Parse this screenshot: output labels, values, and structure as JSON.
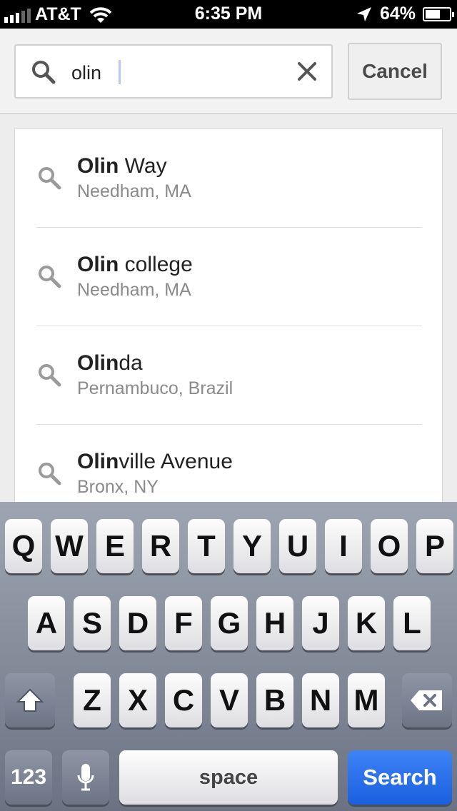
{
  "status_bar": {
    "carrier": "AT&T",
    "time": "6:35 PM",
    "battery": "64%",
    "battery_level": 0.64,
    "icons": [
      "signal-icon",
      "wifi-icon",
      "location-arrow-icon",
      "battery-icon"
    ]
  },
  "search": {
    "value": "olin",
    "cancel_label": "Cancel",
    "icons": [
      "search-icon",
      "clear-icon"
    ]
  },
  "results": [
    {
      "match": "Olin",
      "rest": " Way",
      "subtitle": "Needham, MA"
    },
    {
      "match": "Olin",
      "rest": " college",
      "subtitle": "Needham, MA"
    },
    {
      "match": "Olin",
      "rest": "da",
      "subtitle": "Pernambuco, Brazil"
    },
    {
      "match": "Olin",
      "rest": "ville Avenue",
      "subtitle": "Bronx, NY"
    }
  ],
  "keyboard": {
    "row1": [
      "Q",
      "W",
      "E",
      "R",
      "T",
      "Y",
      "U",
      "I",
      "O",
      "P"
    ],
    "row2": [
      "A",
      "S",
      "D",
      "F",
      "G",
      "H",
      "J",
      "K",
      "L"
    ],
    "row3": [
      "Z",
      "X",
      "C",
      "V",
      "B",
      "N",
      "M"
    ],
    "numbers_label": "123",
    "space_label": "space",
    "search_label": "Search",
    "icons": [
      "shift-icon",
      "backspace-icon",
      "microphone-icon"
    ]
  },
  "colors": {
    "search_key": "#1a5fe0",
    "keyboard_bg": "#6b7383",
    "subtitle_text": "#8a8a8a"
  }
}
